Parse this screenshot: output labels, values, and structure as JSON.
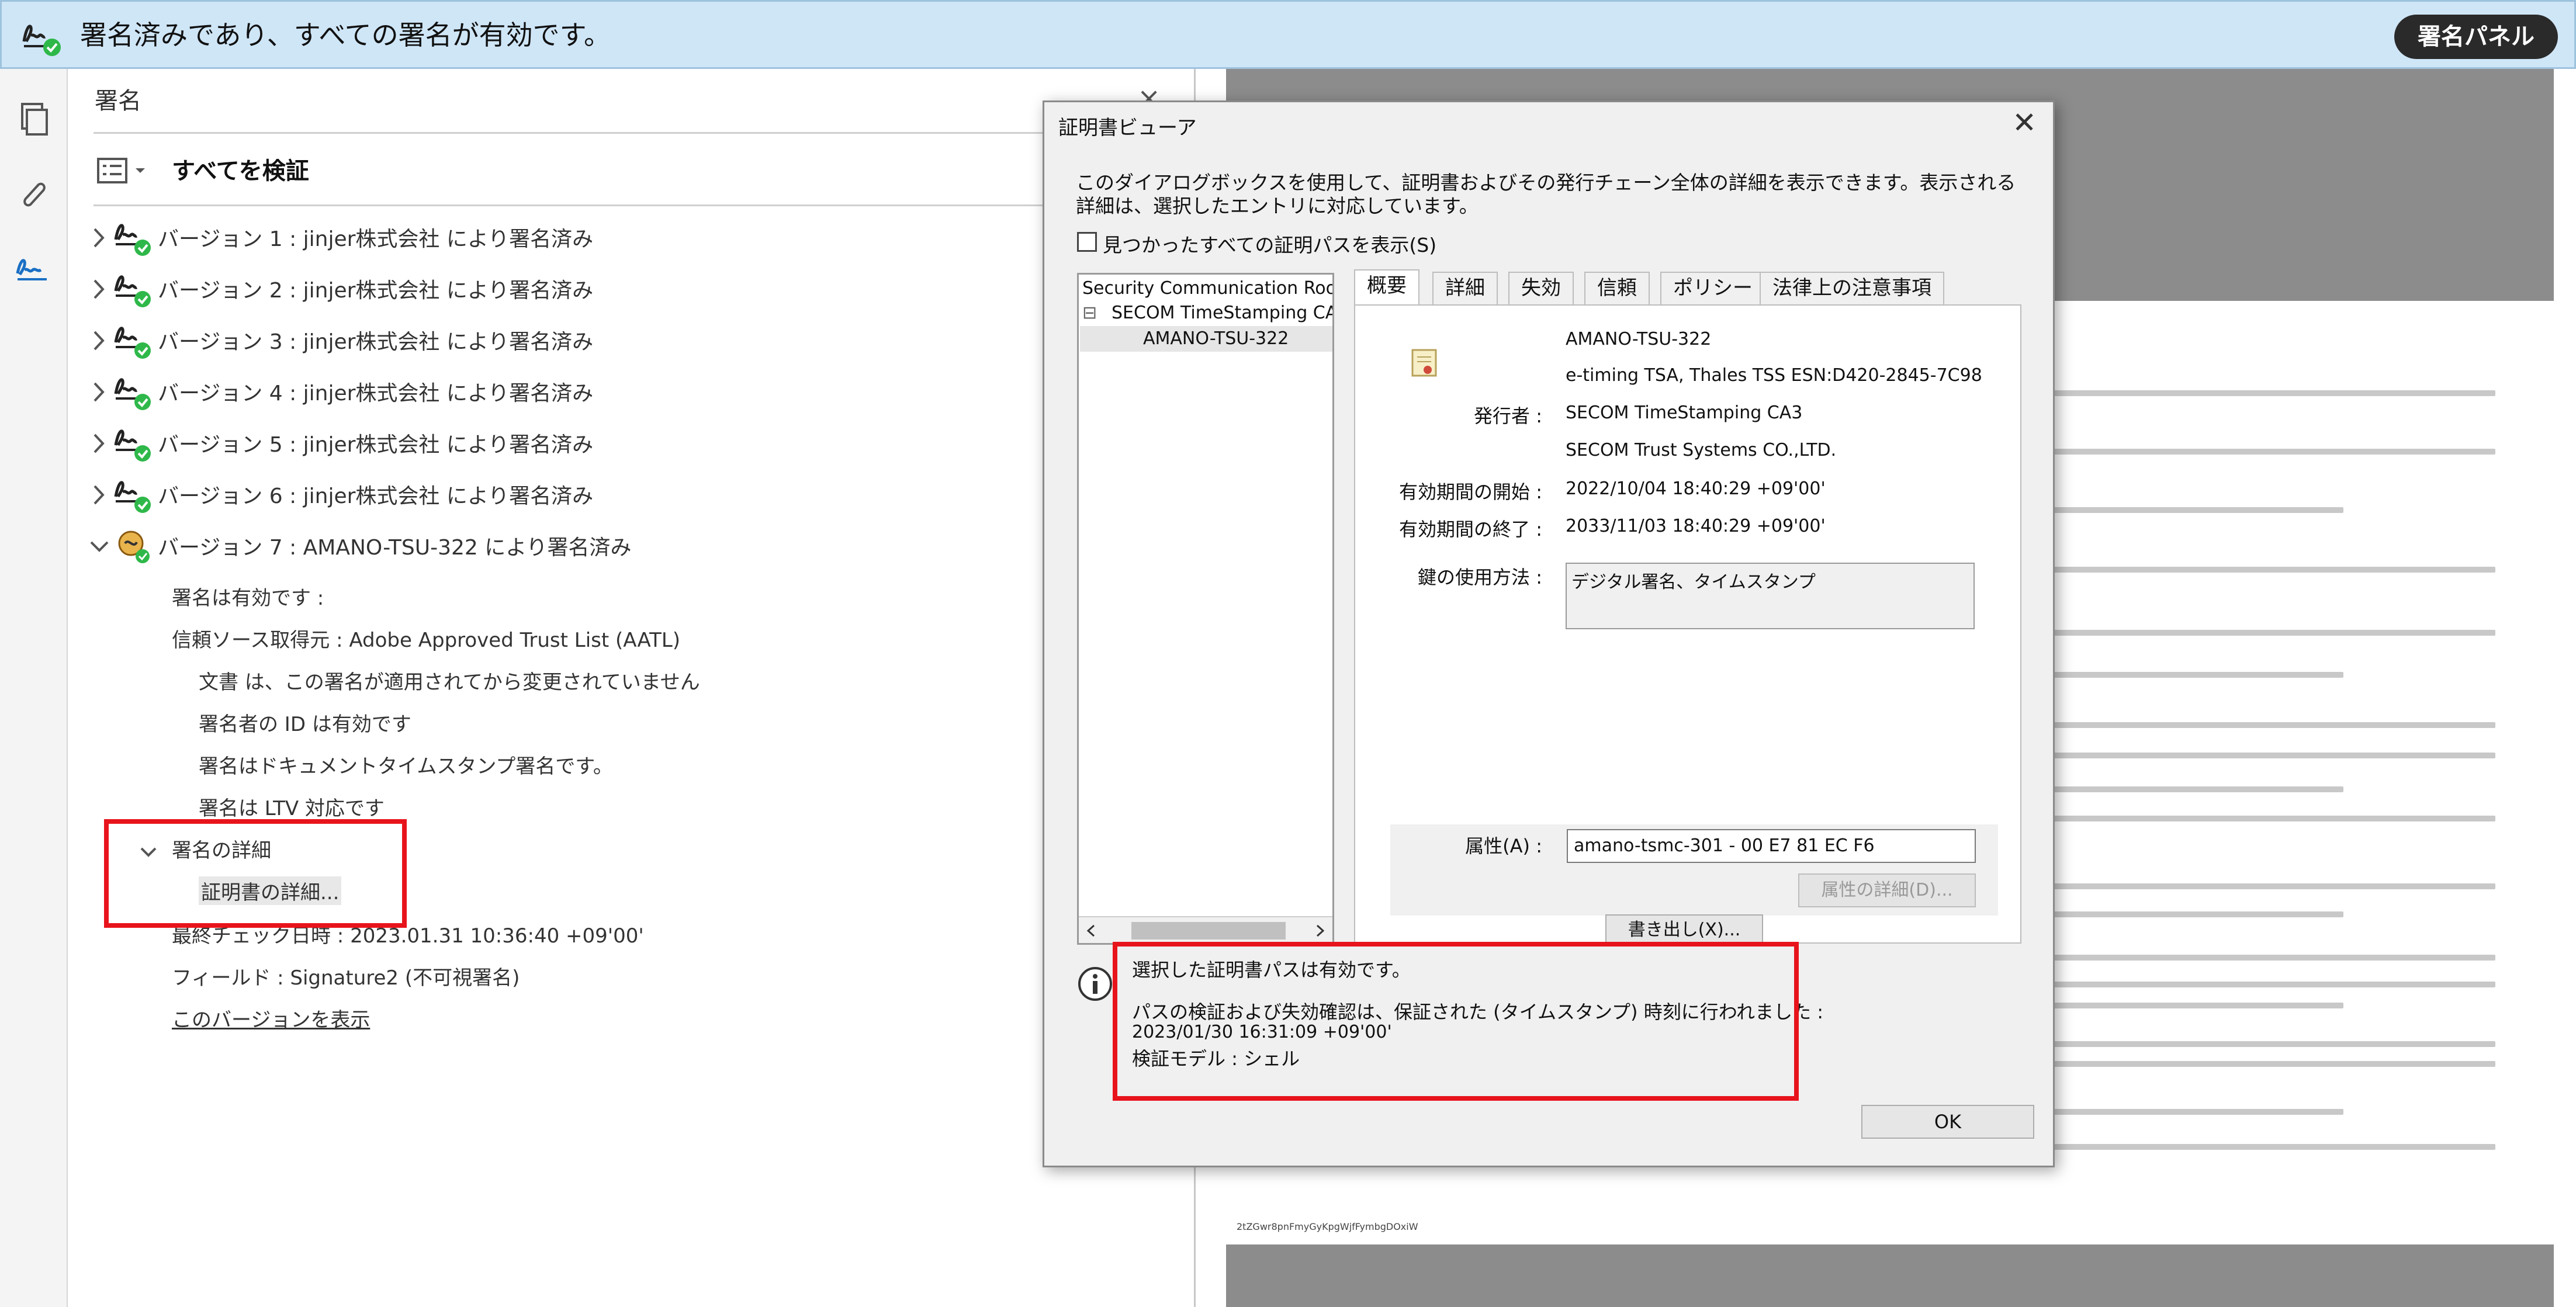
{
  "banner": {
    "text": "署名済みであり、すべての署名が有効です。",
    "panel_button": "署名パネル"
  },
  "rail": {
    "icons": [
      "pages-icon",
      "attachment-icon",
      "signature-icon"
    ]
  },
  "panel": {
    "title": "署名",
    "close": "×",
    "verify_all": "すべてを検証",
    "versions": [
      {
        "label": "バージョン 1 : jinjer株式会社 により署名済み"
      },
      {
        "label": "バージョン 2 : jinjer株式会社 により署名済み"
      },
      {
        "label": "バージョン 3 : jinjer株式会社 により署名済み"
      },
      {
        "label": "バージョン 4 : jinjer株式会社 により署名済み"
      },
      {
        "label": "バージョン 5 : jinjer株式会社 により署名済み"
      },
      {
        "label": "バージョン 6 : jinjer株式会社 により署名済み"
      },
      {
        "label": "バージョン 7 : AMANO-TSU-322 により署名済み"
      }
    ],
    "details": {
      "valid": "署名は有効です :",
      "trust_source": "信頼ソース取得元 : Adobe Approved Trust List (AATL)",
      "unchanged": "文書 は、この署名が適用されてから変更されていません",
      "signer_id": "署名者の ID は有効です",
      "doc_timestamp": "署名はドキュメントタイムスタンプ署名です。",
      "ltv": "署名は LTV 対応です",
      "sig_details": "署名の詳細",
      "cert_details": "証明書の詳細...",
      "last_check": "最終チェック日時 : 2023.01.31 10:36:40 +09'00'",
      "field": "フィールド : Signature2 (不可視署名)",
      "show_version": "このバージョンを表示"
    }
  },
  "document": {
    "code": "2tZGwr8pnFmyGyKpgWjfFymbgDOxiW"
  },
  "dialog": {
    "title": "証明書ビューア",
    "close": "✕",
    "description": "このダイアログボックスを使用して、証明書およびその発行チェーン全体の詳細を表示できます。表示される詳細は、選択したエントリに対応しています。",
    "show_all_paths": "見つかったすべての証明パスを表示(S)",
    "tree": {
      "root": "Security Communication RootC",
      "intermediate": "SECOM TimeStamping CA3",
      "leaf": "AMANO-TSU-322",
      "collapse": "⊟"
    },
    "tabs": [
      "概要",
      "詳細",
      "失効",
      "信頼",
      "ポリシー",
      "法律上の注意事項"
    ],
    "summary": {
      "subject": "AMANO-TSU-322",
      "subject_org": "e-timing TSA, Thales TSS ESN:D420-2845-7C98",
      "issuer_label": "発行者 :",
      "issuer": "SECOM TimeStamping CA3",
      "issuer_org": "SECOM Trust Systems CO.,LTD.",
      "valid_from_label": "有効期間の開始 :",
      "valid_from": "2022/10/04 18:40:29 +09'00'",
      "valid_to_label": "有効期間の終了 :",
      "valid_to": "2033/11/03 18:40:29 +09'00'",
      "key_usage_label": "鍵の使用方法 :",
      "key_usage": "デジタル署名、タイムスタンプ",
      "attr_label": "属性(A) :",
      "attr_value": "amano-tsmc-301 - 00 E7 81 EC F6",
      "attr_details": "属性の詳細(D)...",
      "export": "書き出し(X)..."
    },
    "status": {
      "line1": "選択した証明書パスは有効です。",
      "line2": "パスの検証および失効確認は、保証された (タイムスタンプ) 時刻に行われました :",
      "line3": "2023/01/30 16:31:09 +09'00'",
      "line4": "検証モデル : シェル"
    },
    "ok": "OK"
  },
  "colors": {
    "banner_bg": "#cfe6f7",
    "highlight_red": "#e8141c",
    "valid_green": "#2fb84a"
  }
}
